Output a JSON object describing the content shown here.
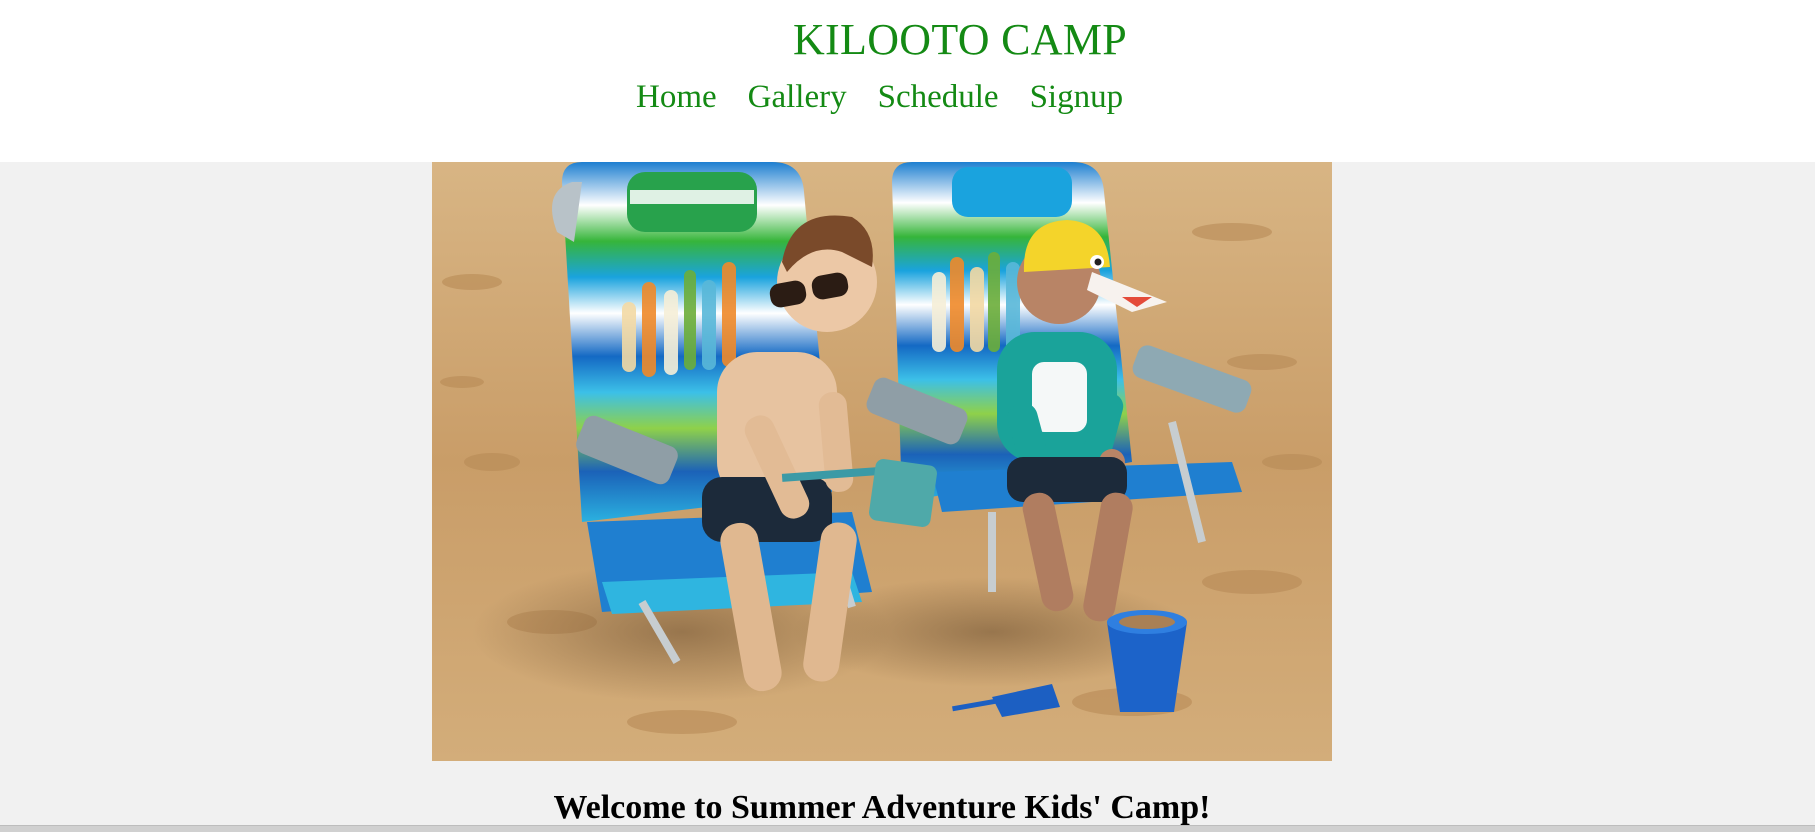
{
  "header": {
    "title": "KILOOTO CAMP",
    "nav": [
      {
        "label": "Home"
      },
      {
        "label": "Gallery"
      },
      {
        "label": "Schedule"
      },
      {
        "label": "Signup"
      }
    ]
  },
  "hero": {
    "image_subject": "two-kids-in-beach-chairs-playing-in-sand"
  },
  "main": {
    "heading": "Welcome to Summer Adventure Kids' Camp!"
  },
  "colors": {
    "brand_green": "#148a14",
    "page_background": "#f1f1f1",
    "header_background": "#ffffff"
  }
}
